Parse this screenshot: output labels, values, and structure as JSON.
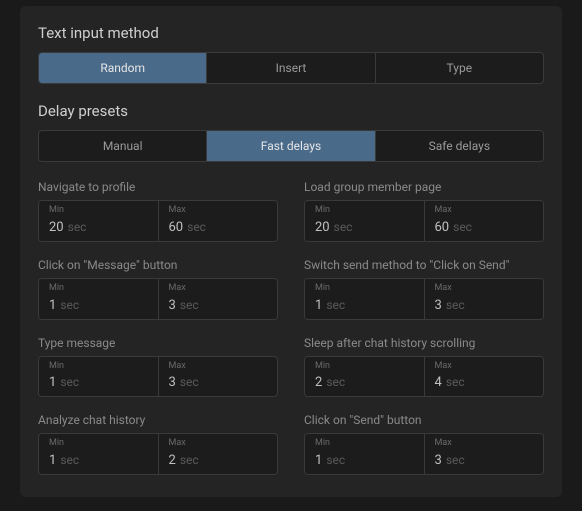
{
  "titles": {
    "text_input": "Text input method",
    "delay_presets": "Delay presets"
  },
  "text_input_tabs": {
    "items": [
      {
        "label": "Random",
        "active": true
      },
      {
        "label": "Insert",
        "active": false
      },
      {
        "label": "Type",
        "active": false
      }
    ]
  },
  "delay_tabs": {
    "items": [
      {
        "label": "Manual",
        "active": false
      },
      {
        "label": "Fast delays",
        "active": true
      },
      {
        "label": "Safe delays",
        "active": false
      }
    ]
  },
  "labels": {
    "min": "Min",
    "max": "Max",
    "unit": "sec"
  },
  "delays": [
    {
      "name": "Navigate to profile",
      "min": "20",
      "max": "60"
    },
    {
      "name": "Load group member page",
      "min": "20",
      "max": "60"
    },
    {
      "name": "Click on \"Message\" button",
      "min": "1",
      "max": "3"
    },
    {
      "name": "Switch send method to \"Click on Send\"",
      "min": "1",
      "max": "3"
    },
    {
      "name": "Type message",
      "min": "1",
      "max": "3"
    },
    {
      "name": "Sleep after chat history scrolling",
      "min": "2",
      "max": "4"
    },
    {
      "name": "Analyze chat history",
      "min": "1",
      "max": "2"
    },
    {
      "name": "Click on \"Send\" button",
      "min": "1",
      "max": "3"
    }
  ]
}
